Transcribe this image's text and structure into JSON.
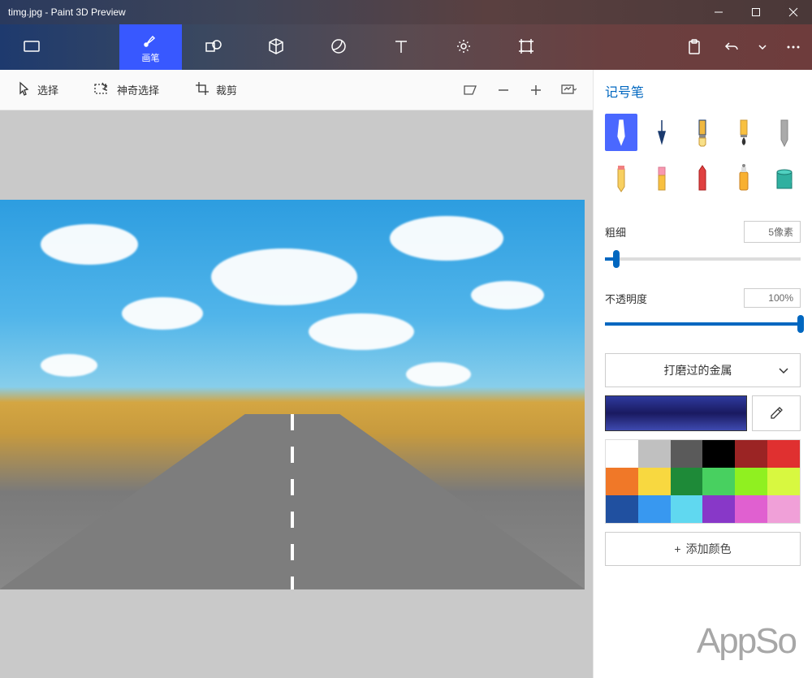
{
  "title": "timg.jpg - Paint 3D Preview",
  "toolbar": {
    "brush_label": "画笔"
  },
  "subtool": {
    "select": "选择",
    "magic_select": "神奇选择",
    "crop": "裁剪"
  },
  "panel": {
    "title": "记号笔",
    "thickness_label": "粗细",
    "thickness_value": "5像素",
    "opacity_label": "不透明度",
    "opacity_value": "100%",
    "material_label": "打磨过的金属",
    "add_color": "添加颜色"
  },
  "palette": [
    "#ffffff",
    "#c0c0c0",
    "#5a5a5a",
    "#000000",
    "#9b2424",
    "#e03030",
    "#f07828",
    "#f8d840",
    "#1e8a38",
    "#48d060",
    "#90f020",
    "#d8f840",
    "#2050a0",
    "#3898f0",
    "#60d8f0",
    "#8838c8",
    "#e060d0",
    "#f0a0d8"
  ],
  "thickness_pct": 6,
  "opacity_pct": 100,
  "watermark": "AppSo"
}
